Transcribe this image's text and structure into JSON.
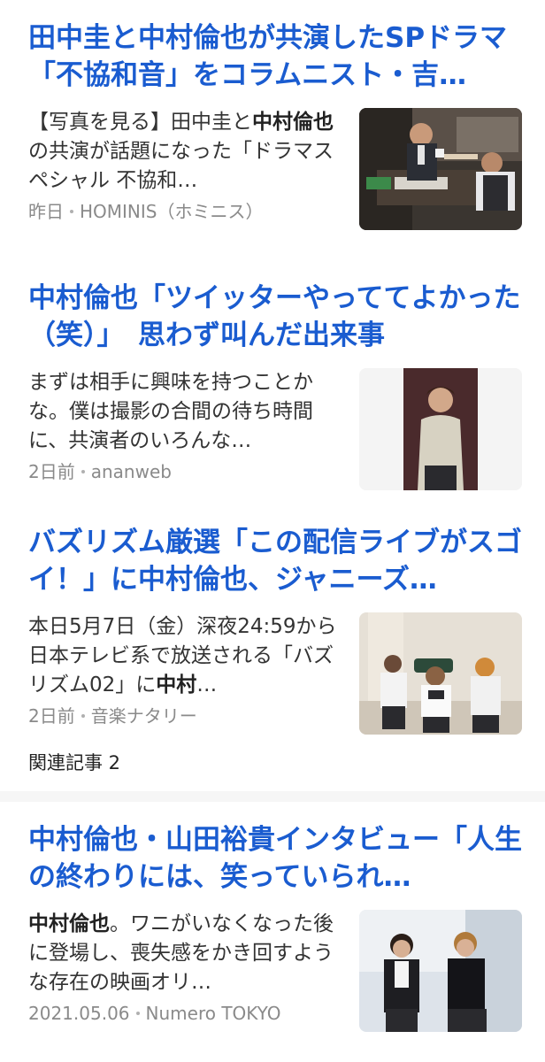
{
  "articles": [
    {
      "title": "田中圭と中村倫也が共演したSPドラマ「不協和音」をコラムニスト・吉…",
      "snippet_parts": [
        {
          "text": "【写真を見る】田中圭と",
          "bold": false
        },
        {
          "text": "中村倫也",
          "bold": true
        },
        {
          "text": "の共演が話題になった「ドラマスペシャル 不協和…",
          "bold": false
        }
      ],
      "time": "昨日",
      "source": "HOMINIS（ホミニス）",
      "thumb_icon": "office-scene-photo",
      "related": ""
    },
    {
      "title": "中村倫也「ツイッターやっててよかった（笑）」　思わず叫んだ出来事",
      "snippet_parts": [
        {
          "text": "まずは相手に興味を持つことかな。僕は撮影の合間の待ち時間に、共演者のいろんな…",
          "bold": false
        }
      ],
      "time": "2日前",
      "source": "ananweb",
      "thumb_icon": "portrait-photo",
      "related": ""
    },
    {
      "title": "バズリズム厳選「この配信ライブがスゴイ！」に中村倫也、ジャニーズ…",
      "snippet_parts": [
        {
          "text": "本日5月7日（金）深夜24:59から日本テレビ系で放送される「バズリズム02」に",
          "bold": false
        },
        {
          "text": "中村",
          "bold": true
        },
        {
          "text": "…",
          "bold": false
        }
      ],
      "time": "2日前",
      "source": "音楽ナタリー",
      "thumb_icon": "band-photo",
      "related": "関連記事 2"
    },
    {
      "title": "中村倫也・山田裕貴インタビュー「人生の終わりには、笑っていられ…",
      "snippet_parts": [
        {
          "text": "中村倫也",
          "bold": true
        },
        {
          "text": "。ワニがいなくなった後に登場し、喪失感をかき回すような存在の映画オリ…",
          "bold": false
        }
      ],
      "time": "2021.05.06",
      "source": "Numero TOKYO",
      "thumb_icon": "duo-photo",
      "related": ""
    }
  ],
  "colors": {
    "title": "#1a5cd0",
    "meta": "#8a8a8a",
    "background": "#f6f6f6"
  }
}
